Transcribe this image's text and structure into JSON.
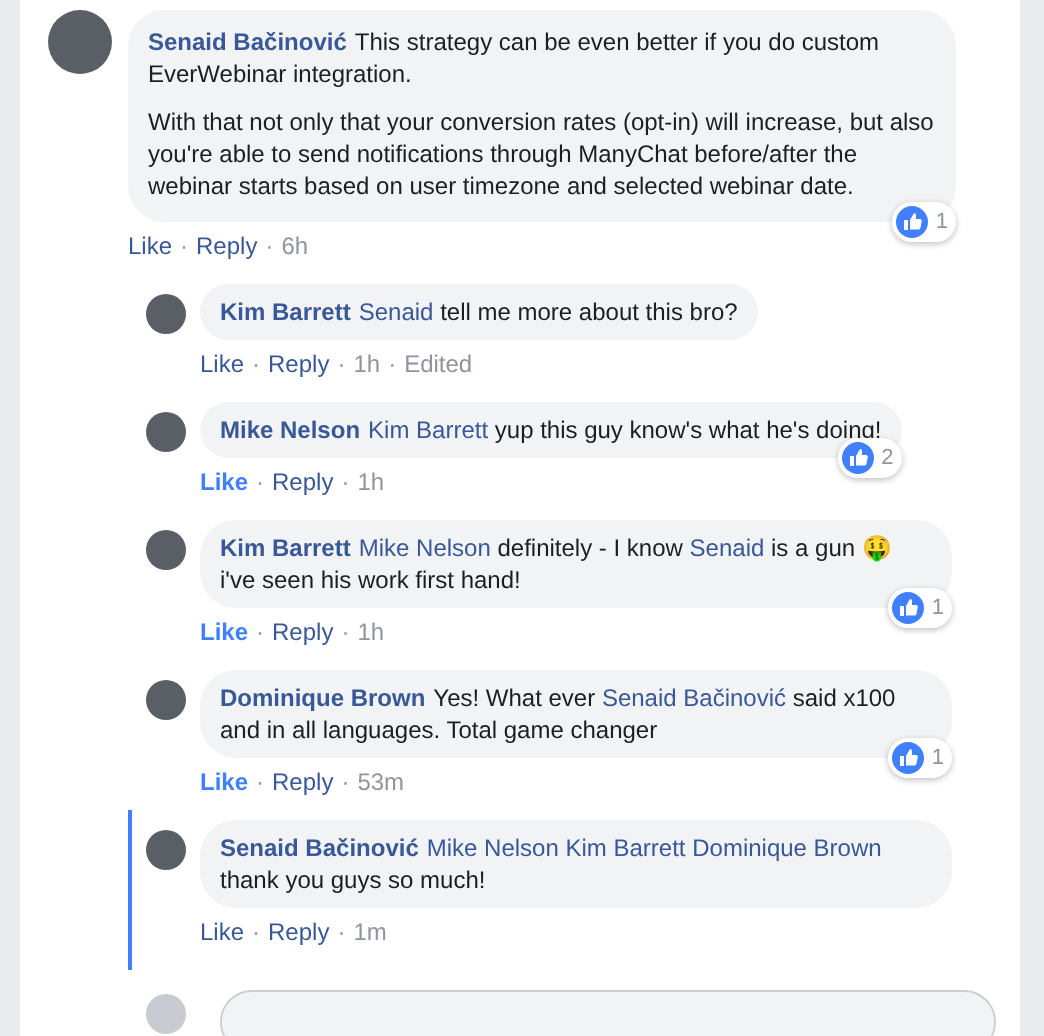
{
  "comments": [
    {
      "author": "Senaid Bačinović",
      "reply": false,
      "highlighted": false,
      "liked": false,
      "paragraphs": [
        [
          {
            "kind": "text",
            "text": "This strategy can be even better if you do custom EverWebinar integration."
          }
        ],
        [
          {
            "kind": "text",
            "text": "With that not only that your conversion rates (opt-in) will increase, but also you're able to send notifications through ManyChat before/after the webinar starts based on user timezone and selected webinar date."
          }
        ]
      ],
      "reactions": "1",
      "actions": [
        "Like",
        "Reply"
      ],
      "time": "6h"
    },
    {
      "author": "Kim Barrett",
      "reply": true,
      "highlighted": false,
      "liked": false,
      "paragraphs": [
        [
          {
            "kind": "mention",
            "text": "Senaid"
          },
          {
            "kind": "text",
            "text": "tell me more about this bro?"
          }
        ]
      ],
      "actions": [
        "Like",
        "Reply"
      ],
      "time": "1h",
      "edited": "Edited"
    },
    {
      "author": "Mike Nelson",
      "reply": true,
      "highlighted": false,
      "liked": true,
      "paragraphs": [
        [
          {
            "kind": "mention",
            "text": "Kim Barrett"
          },
          {
            "kind": "text",
            "text": "yup this guy know's what he's doing!"
          }
        ]
      ],
      "reactions": "2",
      "actions": [
        "Like",
        "Reply"
      ],
      "time": "1h"
    },
    {
      "author": "Kim Barrett",
      "reply": true,
      "highlighted": false,
      "liked": true,
      "paragraphs": [
        [
          {
            "kind": "mention",
            "text": "Mike Nelson"
          },
          {
            "kind": "text",
            "text": "definitely - I know"
          },
          {
            "kind": "mention",
            "text": "Senaid"
          },
          {
            "kind": "text",
            "text": "is a gun 🤑 i've seen his work first hand!"
          }
        ]
      ],
      "reactions": "1",
      "actions": [
        "Like",
        "Reply"
      ],
      "time": "1h"
    },
    {
      "author": "Dominique Brown",
      "reply": true,
      "highlighted": false,
      "liked": true,
      "paragraphs": [
        [
          {
            "kind": "text",
            "text": "Yes! What ever"
          },
          {
            "kind": "mention",
            "text": "Senaid Bačinović"
          },
          {
            "kind": "text",
            "text": "said x100 and in all languages. Total game changer"
          }
        ]
      ],
      "reactions": "1",
      "actions": [
        "Like",
        "Reply"
      ],
      "time": "53m"
    },
    {
      "author": "Senaid Bačinović",
      "reply": true,
      "highlighted": true,
      "liked": false,
      "paragraphs": [
        [
          {
            "kind": "mention",
            "text": "Mike Nelson"
          },
          {
            "kind": "mention",
            "text": "Kim Barrett"
          },
          {
            "kind": "mention",
            "text": "Dominique Brown"
          },
          {
            "kind": "text",
            "text": "thank you guys so much!"
          }
        ]
      ],
      "actions": [
        "Like",
        "Reply"
      ],
      "time": "1m"
    }
  ],
  "separator": "·",
  "reply_box": {
    "visible": true
  }
}
